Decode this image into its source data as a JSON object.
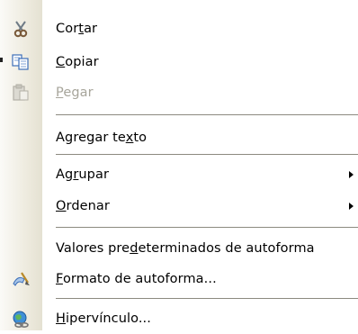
{
  "menu": {
    "items": [
      {
        "id": "cortar",
        "pre": "Cor",
        "acc": "t",
        "post": "ar",
        "icon": "scissors-icon",
        "disabled": false,
        "submenu": false
      },
      {
        "id": "copiar",
        "pre": "",
        "acc": "C",
        "post": "opiar",
        "icon": "copy-icon",
        "disabled": false,
        "submenu": false
      },
      {
        "id": "pegar",
        "pre": "",
        "acc": "P",
        "post": "egar",
        "icon": "paste-icon",
        "disabled": true,
        "submenu": false
      },
      {
        "id": "agregar-texto",
        "pre": "Agregar te",
        "acc": "x",
        "post": "to",
        "icon": "",
        "disabled": false,
        "submenu": false
      },
      {
        "id": "agrupar",
        "pre": "Ag",
        "acc": "r",
        "post": "upar",
        "icon": "",
        "disabled": false,
        "submenu": true
      },
      {
        "id": "ordenar",
        "pre": "",
        "acc": "O",
        "post": "rdenar",
        "icon": "",
        "disabled": false,
        "submenu": true
      },
      {
        "id": "valores",
        "pre": "Valores pre",
        "acc": "d",
        "post": "eterminados de autoforma",
        "icon": "",
        "disabled": false,
        "submenu": false
      },
      {
        "id": "formato",
        "pre": "",
        "acc": "F",
        "post": "ormato de autoforma...",
        "icon": "format-autoshape-icon",
        "disabled": false,
        "submenu": false
      },
      {
        "id": "hipervinculo",
        "pre": "",
        "acc": "H",
        "post": "ipervínculo...",
        "icon": "hyperlink-icon",
        "disabled": false,
        "submenu": false
      }
    ]
  },
  "colors": {
    "gutter": "#ece9dc",
    "disabled_text": "#a7a59b",
    "separator": "#8c8a80"
  }
}
